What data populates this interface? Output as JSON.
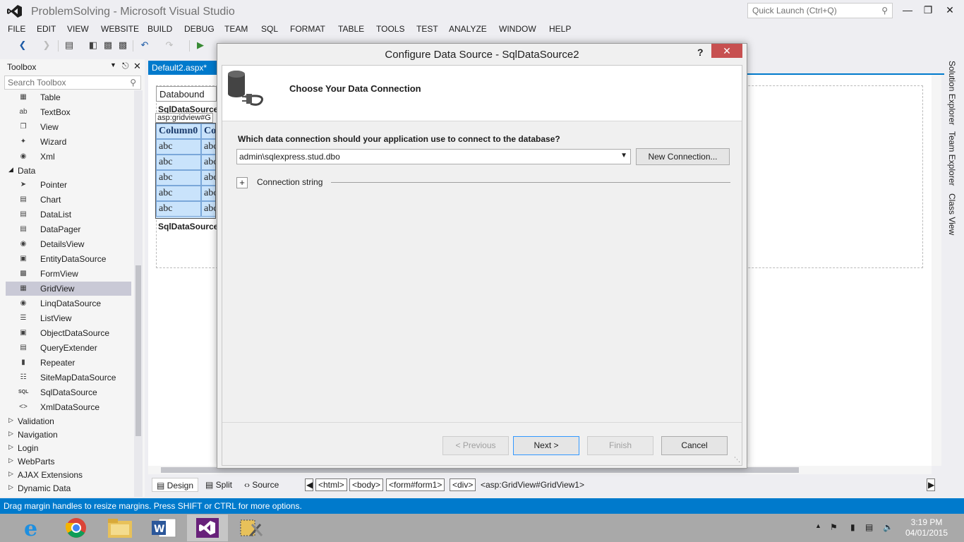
{
  "window": {
    "title": "ProblemSolving - Microsoft Visual Studio",
    "quick_launch_placeholder": "Quick Launch (Ctrl+Q)"
  },
  "menu": [
    "FILE",
    "EDIT",
    "VIEW",
    "WEBSITE",
    "BUILD",
    "DEBUG",
    "TEAM",
    "SQL",
    "FORMAT",
    "TABLE",
    "TOOLS",
    "TEST",
    "ANALYZE",
    "WINDOW",
    "HELP"
  ],
  "toolbox": {
    "title": "Toolbox",
    "search_placeholder": "Search Toolbox",
    "items_top": [
      {
        "label": "Table",
        "icon": "table-icon"
      },
      {
        "label": "TextBox",
        "icon": "textbox-icon"
      },
      {
        "label": "View",
        "icon": "view-icon"
      },
      {
        "label": "Wizard",
        "icon": "wizard-icon"
      },
      {
        "label": "Xml",
        "icon": "xml-icon"
      }
    ],
    "data_group": "Data",
    "data_items": [
      {
        "label": "Pointer",
        "icon": "pointer-icon"
      },
      {
        "label": "Chart",
        "icon": "chart-icon"
      },
      {
        "label": "DataList",
        "icon": "datalist-icon"
      },
      {
        "label": "DataPager",
        "icon": "datapager-icon"
      },
      {
        "label": "DetailsView",
        "icon": "detailsview-icon"
      },
      {
        "label": "EntityDataSource",
        "icon": "entitydatasource-icon"
      },
      {
        "label": "FormView",
        "icon": "formview-icon"
      },
      {
        "label": "GridView",
        "icon": "gridview-icon",
        "selected": true
      },
      {
        "label": "LinqDataSource",
        "icon": "linqdatasource-icon"
      },
      {
        "label": "ListView",
        "icon": "listview-icon"
      },
      {
        "label": "ObjectDataSource",
        "icon": "objectdatasource-icon"
      },
      {
        "label": "QueryExtender",
        "icon": "queryextender-icon"
      },
      {
        "label": "Repeater",
        "icon": "repeater-icon"
      },
      {
        "label": "SiteMapDataSource",
        "icon": "sitemapdatasource-icon"
      },
      {
        "label": "SqlDataSource",
        "icon": "sqldatasource-icon"
      },
      {
        "label": "XmlDataSource",
        "icon": "xmldatasource-icon"
      }
    ],
    "collapsed_groups": [
      "Validation",
      "Navigation",
      "Login",
      "WebParts",
      "AJAX Extensions",
      "Dynamic Data"
    ]
  },
  "document": {
    "tab": "Default2.aspx*",
    "databound": "Databound",
    "sqldatasource_label": "SqlDataSource",
    "grid_tag": "asp:gridview#G",
    "grid_header": [
      "Column0",
      "Col"
    ],
    "grid_cell": "abc",
    "sqldatasource_label2": "SqlDataSource"
  },
  "viewbar": {
    "design": "Design",
    "split": "Split",
    "source": "Source",
    "crumbs": [
      "<html>",
      "<body>",
      "<form#form1>",
      "<div>"
    ],
    "crumb_last": "<asp:GridView#GridView1>"
  },
  "statusbar": "Drag margin handles to resize margins. Press SHIFT or CTRL for more options.",
  "side_tabs": [
    "Solution Explorer",
    "Team Explorer",
    "Class View"
  ],
  "dialog": {
    "title": "Configure Data Source - SqlDataSource2",
    "help": "?",
    "heading": "Choose Your Data Connection",
    "question": "Which data connection should your application use to connect to the database?",
    "connection_value": "admin\\sqlexpress.stud.dbo",
    "new_connection": "New Connection...",
    "connection_string_label": "Connection string",
    "expander": "+",
    "buttons": {
      "previous": "< Previous",
      "next": "Next >",
      "finish": "Finish",
      "cancel": "Cancel"
    }
  },
  "taskbar": {
    "time": "3:19 PM",
    "date": "04/01/2015"
  },
  "colors": {
    "accent": "#007acc",
    "close": "#c75050",
    "selection": "#c9c9d6"
  }
}
